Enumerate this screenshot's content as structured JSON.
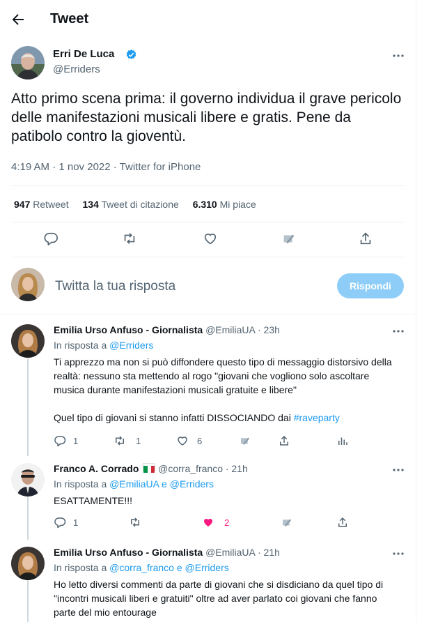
{
  "header": {
    "title": "Tweet"
  },
  "tweet": {
    "author_name": "Erri De Luca",
    "author_handle": "@Erriders",
    "text": "Atto primo scena prima: il governo individua il grave pericolo delle manifestazioni musicali libere e gratis. Pene da patibolo contro la gioventù.",
    "meta": "4:19 AM · 1 nov 2022 · Twitter for iPhone",
    "retweets_count": "947",
    "retweets_label": "Retweet",
    "quotes_count": "134",
    "quotes_label": "Tweet di citazione",
    "likes_count": "6.310",
    "likes_label": "Mi piace"
  },
  "reply_box": {
    "placeholder": "Twitta la tua risposta",
    "button": "Rispondi"
  },
  "replies": [
    {
      "name": "Emilia Urso Anfuso - Giornalista",
      "handle": "@EmiliaUA",
      "time": "· 23h",
      "in_reply_prefix": "In risposta a ",
      "in_reply_to": "@Erriders",
      "text": "Ti apprezzo ma non si può diffondere questo tipo di messaggio distorsivo della realtà: nessuno sta mettendo al rogo \"giovani che vogliono solo ascoltare musica durante manifestazioni musicali gratuite e libere\"\n\nQuel tipo di giovani si stanno infatti DISSOCIANDO dai ",
      "hashtag": "#raveparty",
      "reply_count": "1",
      "retweet_count": "1",
      "like_count": "6"
    },
    {
      "name": "Franco A. Corrado",
      "handle": "@corra_franco",
      "time": "· 21h",
      "in_reply_prefix": "In risposta a ",
      "in_reply_to": "@EmiliaUA e @Erriders",
      "text": "ESATTAMENTE!!!",
      "reply_count": "1",
      "like_count": "2"
    },
    {
      "name": "Emilia Urso Anfuso - Giornalista",
      "handle": "@EmiliaUA",
      "time": "· 21h",
      "in_reply_prefix": "In risposta a ",
      "in_reply_to": "@corra_franco e @Erriders",
      "text": "Ho letto diversi commenti da parte di giovani che si disdiciano da quel tipo di \"incontri musicali liberi e gratuiti\" oltre ad aver parlato coi giovani che fanno parte del mio entourage"
    }
  ],
  "icons": {
    "back": "arrow-left-icon",
    "verified": "verified-badge-icon",
    "more": "more-horizontal-icon",
    "reply": "reply-icon",
    "retweet": "retweet-icon",
    "like": "heart-icon",
    "bookmark": "bookmark-icon",
    "share": "share-icon",
    "analytics": "analytics-icon",
    "flag": "italy-flag-icon"
  },
  "colors": {
    "accent": "#1d9bf0",
    "like": "#f91880",
    "reply_button": "#8ecdf8",
    "muted_text": "#536471"
  }
}
